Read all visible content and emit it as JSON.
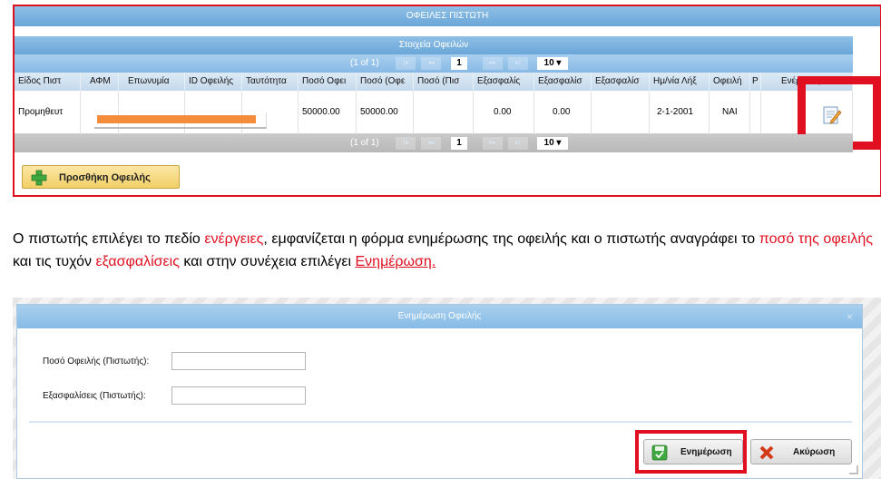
{
  "panel": {
    "title": "ΟΦΕΙΛΕΣ ΠΙΣΤΩΤΗ",
    "subtitle": "Στοιχεία Οφειλών"
  },
  "pager": {
    "count": "(1 of 1)",
    "first": "|◂",
    "prev": "◂◂",
    "next": "▸▸",
    "last": "▸|",
    "page": "1",
    "rows_per_page": "10 ▾"
  },
  "table": {
    "columns": [
      "Είδος Πιστ",
      "ΑΦΜ",
      "Επωνυμία",
      "ID Οφειλής",
      "Ταυτότητα",
      "Ποσό Οφει",
      "Ποσό (Οφε",
      "Ποσό (Πισ",
      "Εξασφαλίς",
      "Εξασφαλίσ",
      "Εξασφαλίσ",
      "Ημ/νία Λήξ",
      "Οφειλή",
      "Ρ",
      "Ενέργειες"
    ],
    "rows": [
      [
        "Προμηθευτ",
        "",
        "",
        "",
        "",
        "50000.00",
        "50000.00",
        "",
        "0.00",
        "0.00",
        "",
        "2-1-2001",
        "ΝΑΙ",
        "",
        ""
      ]
    ]
  },
  "add_button": "Προσθήκη Οφειλής",
  "instruction": {
    "p1": "Ο πιστωτής επιλέγει το πεδίο ",
    "h1": "ενέργειες",
    "p2": ", εμφανίζεται η φόρμα ενημέρωσης της οφειλής και ο πιστωτής αναγράφει το ",
    "h2": "ποσό της οφειλής",
    "p3": " και τις τυχόν ",
    "h3": "εξασφαλίσεις",
    "p4": " και στην συνέχεια επιλέγει ",
    "h4": "Ενημέρωση."
  },
  "dialog": {
    "title": "Ενημέρωση Οφειλής",
    "close": "×",
    "field_amount_label": "Ποσό Οφειλής (Πιστωτής):",
    "field_amount_value": "",
    "field_collateral_label": "Εξασφαλίσεις (Πιστωτής):",
    "field_collateral_value": "",
    "update_button": "Ενημέρωση",
    "cancel_button": "Ακύρωση"
  },
  "colors": {
    "highlight": "#e01020",
    "header_blue": "#7ab3e0",
    "redaction": "#f58c3c"
  }
}
